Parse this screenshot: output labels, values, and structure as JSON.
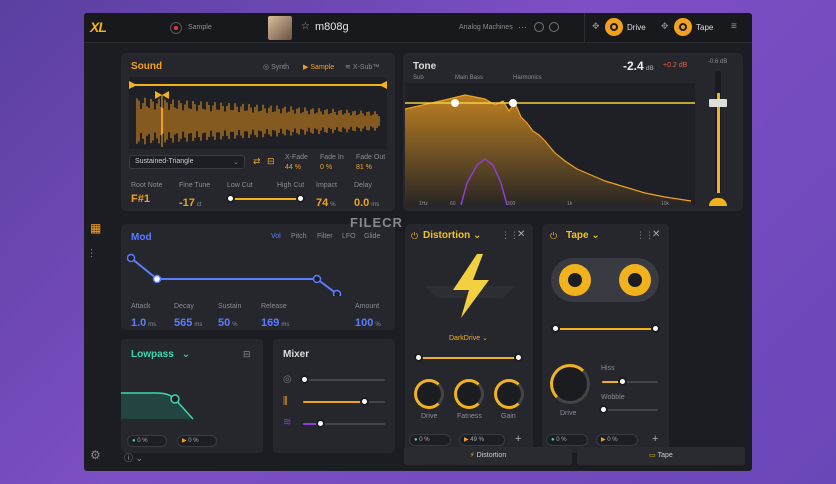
{
  "topbar": {
    "logo": "XL",
    "sample_label": "Sample",
    "preset_name": "m808g",
    "category": "Analog Machines",
    "more": "···",
    "fx_drive": "Drive",
    "fx_tape": "Tape"
  },
  "sound": {
    "title": "Sound",
    "tabs": [
      "Synth",
      "Sample",
      "X-Sub™"
    ],
    "waveform_select": "Sustained-Triangle",
    "xfade": {
      "label": "X-Fade",
      "value": "44 %"
    },
    "fade_in": {
      "label": "Fade In",
      "value": "0 %"
    },
    "fade_out": {
      "label": "Fade Out",
      "value": "81 %"
    },
    "root_note": {
      "label": "Root Note",
      "value": "F#1"
    },
    "fine_tune": {
      "label": "Fine Tune",
      "value": "-17",
      "unit": "ct"
    },
    "low_cut": "Low Cut",
    "high_cut": "High Cut",
    "impact": {
      "label": "Impact",
      "value": "74",
      "unit": "%"
    },
    "delay": {
      "label": "Delay",
      "value": "0.0",
      "unit": "ms"
    }
  },
  "tone": {
    "title": "Tone",
    "gain": "-2.4",
    "gain_unit": "dB",
    "gain_delta": "+0.2 dB",
    "labels": [
      "Sub",
      "Main Bass",
      "Harmonics"
    ],
    "freqs": [
      "1Hz",
      "60",
      "300",
      "1k",
      "10k"
    ],
    "meter_value": "-0.6 dB"
  },
  "mod": {
    "title": "Mod",
    "tabs": [
      "Vol",
      "Pitch",
      "Filter",
      "LFO",
      "Glide"
    ],
    "attack": {
      "label": "Attack",
      "value": "1.0",
      "unit": "ms"
    },
    "decay": {
      "label": "Decay",
      "value": "565",
      "unit": "ms"
    },
    "sustain": {
      "label": "Sustain",
      "value": "50",
      "unit": "%"
    },
    "release": {
      "label": "Release",
      "value": "169",
      "unit": "ms"
    },
    "amount": {
      "label": "Amount",
      "value": "100",
      "unit": "%"
    }
  },
  "distortion": {
    "title": "Distortion",
    "type": "DarkDrive",
    "knobs": [
      "Drive",
      "Fatness",
      "Gain"
    ],
    "mix1": "0 %",
    "mix2": "49 %"
  },
  "tape": {
    "title": "Tape",
    "drive": "Drive",
    "hiss": "Hiss",
    "wobble": "Wobble",
    "mix1": "0 %",
    "mix2": "0 %"
  },
  "lowpass": {
    "title": "Lowpass",
    "mix1": "0 %",
    "mix2": "0 %"
  },
  "mixer": {
    "title": "Mixer"
  },
  "bottom": {
    "distortion_tab": "Distortion",
    "tape_tab": "Tape"
  },
  "watermark": "FILECR",
  "colors": {
    "accent": "#f2b21d",
    "blue": "#5a7dff",
    "green": "#3dd6b0",
    "purple": "#8a3fd6"
  }
}
